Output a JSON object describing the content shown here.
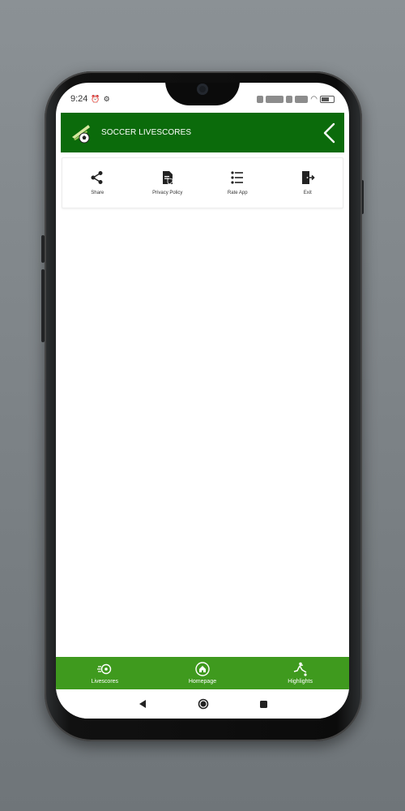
{
  "status_bar": {
    "time": "9:24"
  },
  "app_bar": {
    "title": "SOCCER LIVESCORES"
  },
  "menu": {
    "items": [
      {
        "label": "Share",
        "icon": "share-icon"
      },
      {
        "label": "Privacy Policy",
        "icon": "privacy-policy-icon"
      },
      {
        "label": "Rate App",
        "icon": "list-icon"
      },
      {
        "label": "Exit",
        "icon": "exit-icon"
      }
    ]
  },
  "bottom_nav": {
    "items": [
      {
        "label": "Livescores",
        "icon": "ball-speed-icon"
      },
      {
        "label": "Homepage",
        "icon": "home-icon"
      },
      {
        "label": "Highlights",
        "icon": "player-kick-icon"
      }
    ]
  },
  "colors": {
    "app_bar": "#0b6b0b",
    "bottom_nav": "#3f9a1e",
    "background": "#ffffff"
  }
}
